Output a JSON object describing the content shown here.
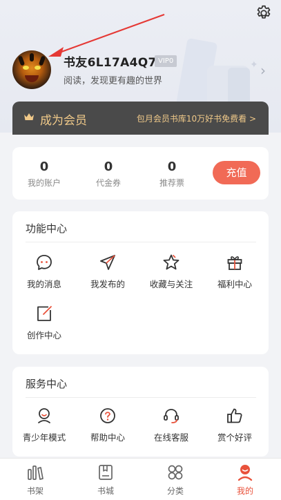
{
  "profile": {
    "username": "书友6L17A4Q7i",
    "vip_label": "VIP0",
    "motto": "阅读，发现更有趣的世界"
  },
  "membership": {
    "title": "成为会员",
    "promo": "包月会员书库10万好书免费看 >"
  },
  "stats": [
    {
      "value": "0",
      "label": "我的账户"
    },
    {
      "value": "0",
      "label": "代金券"
    },
    {
      "value": "0",
      "label": "推荐票"
    }
  ],
  "recharge_label": "充值",
  "function_center": {
    "title": "功能中心",
    "items": [
      {
        "label": "我的消息",
        "icon": "message-icon"
      },
      {
        "label": "我发布的",
        "icon": "send-icon"
      },
      {
        "label": "收藏与关注",
        "icon": "star-icon"
      },
      {
        "label": "福利中心",
        "icon": "gift-icon"
      },
      {
        "label": "创作中心",
        "icon": "edit-icon"
      }
    ]
  },
  "service_center": {
    "title": "服务中心",
    "items": [
      {
        "label": "青少年模式",
        "icon": "teen-mode-icon"
      },
      {
        "label": "帮助中心",
        "icon": "help-icon"
      },
      {
        "label": "在线客服",
        "icon": "headset-icon"
      },
      {
        "label": "赏个好评",
        "icon": "thumbs-up-icon"
      }
    ]
  },
  "nav": [
    {
      "label": "书架",
      "icon": "bookshelf-icon",
      "active": false
    },
    {
      "label": "书城",
      "icon": "bookstore-icon",
      "active": false
    },
    {
      "label": "分类",
      "icon": "category-icon",
      "active": false
    },
    {
      "label": "我的",
      "icon": "profile-icon",
      "active": true
    }
  ],
  "colors": {
    "accent": "#e9523b",
    "recharge": "#f16a56",
    "member_gold": "#f0c989",
    "member_bg": "#4a4a4a",
    "annotation_arrow": "#e53935"
  }
}
